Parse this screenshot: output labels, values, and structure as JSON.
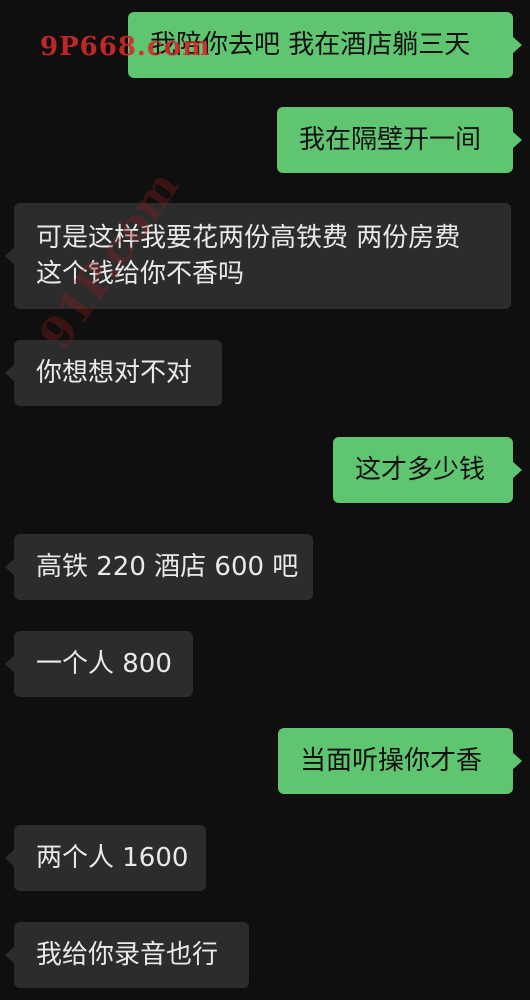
{
  "watermarks": {
    "top": "9P668.com",
    "diagonal": "91P.com"
  },
  "messages": [
    {
      "side": "out",
      "lines": [
        "我陪你去吧 我在酒店躺三天"
      ]
    },
    {
      "side": "out",
      "lines": [
        "我在隔壁开一间"
      ]
    },
    {
      "side": "in",
      "lines": [
        "可是这样我要花两份高铁费 两份房费",
        "这个钱给你不香吗"
      ]
    },
    {
      "side": "in",
      "lines": [
        "你想想对不对"
      ]
    },
    {
      "side": "out",
      "lines": [
        "这才多少钱"
      ]
    },
    {
      "side": "in",
      "lines": [
        "高铁 220 酒店 600 吧"
      ]
    },
    {
      "side": "in",
      "lines": [
        "一个人 800"
      ]
    },
    {
      "side": "out",
      "lines": [
        "当面听操你才香"
      ]
    },
    {
      "side": "in",
      "lines": [
        "两个人 1600"
      ]
    },
    {
      "side": "in",
      "lines": [
        "我给你录音也行"
      ]
    }
  ],
  "colors": {
    "background": "#0f0f0f",
    "outgoing_bubble": "#5fc571",
    "incoming_bubble": "#2c2c2c"
  }
}
